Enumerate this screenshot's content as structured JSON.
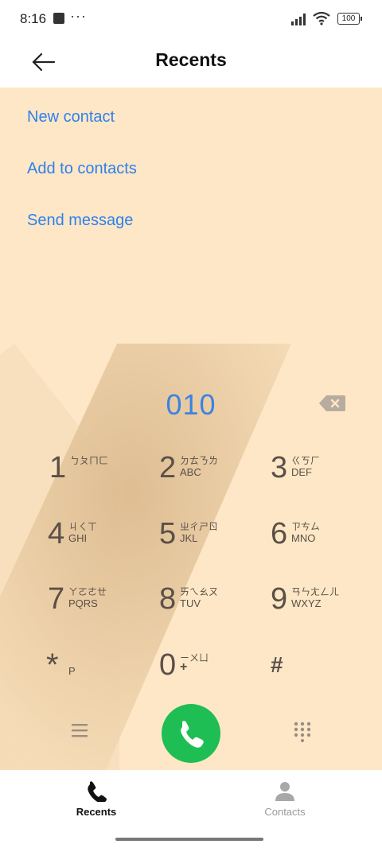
{
  "status_bar": {
    "time": "8:16",
    "dots": "···",
    "battery": "100"
  },
  "header": {
    "title": "Recents"
  },
  "actions": [
    {
      "label": "New contact"
    },
    {
      "label": "Add to contacts"
    },
    {
      "label": "Send message"
    }
  ],
  "dialer": {
    "number": "010",
    "keys": [
      {
        "digit": "1",
        "zhuyin": "ㄅㄆㄇㄈ",
        "letters": ""
      },
      {
        "digit": "2",
        "zhuyin": "ㄉㄊㄋㄌ",
        "letters": "ABC"
      },
      {
        "digit": "3",
        "zhuyin": "ㄍㄎㄏ",
        "letters": "DEF"
      },
      {
        "digit": "4",
        "zhuyin": "ㄐㄑㄒ",
        "letters": "GHI"
      },
      {
        "digit": "5",
        "zhuyin": "ㄓㄔㄕㄖ",
        "letters": "JKL"
      },
      {
        "digit": "6",
        "zhuyin": "ㄗㄘㄙ",
        "letters": "MNO"
      },
      {
        "digit": "7",
        "zhuyin": "ㄚㄛㄜㄝ",
        "letters": "PQRS"
      },
      {
        "digit": "8",
        "zhuyin": "ㄞㄟㄠㄡ",
        "letters": "TUV"
      },
      {
        "digit": "9",
        "zhuyin": "ㄢㄣㄤㄥㄦ",
        "letters": "WXYZ"
      },
      {
        "digit": "*",
        "zhuyin": "",
        "letters": "P"
      },
      {
        "digit": "0",
        "zhuyin": "ㄧㄨㄩ",
        "letters": "+"
      },
      {
        "digit": "#",
        "zhuyin": "",
        "letters": ""
      }
    ]
  },
  "bottom_nav": {
    "tabs": [
      {
        "label": "Recents",
        "active": true
      },
      {
        "label": "Contacts",
        "active": false
      }
    ]
  },
  "colors": {
    "accent": "#2f80ed",
    "background": "#fde7c6",
    "call_green": "#1fbe54",
    "key_text": "#5a5048"
  }
}
